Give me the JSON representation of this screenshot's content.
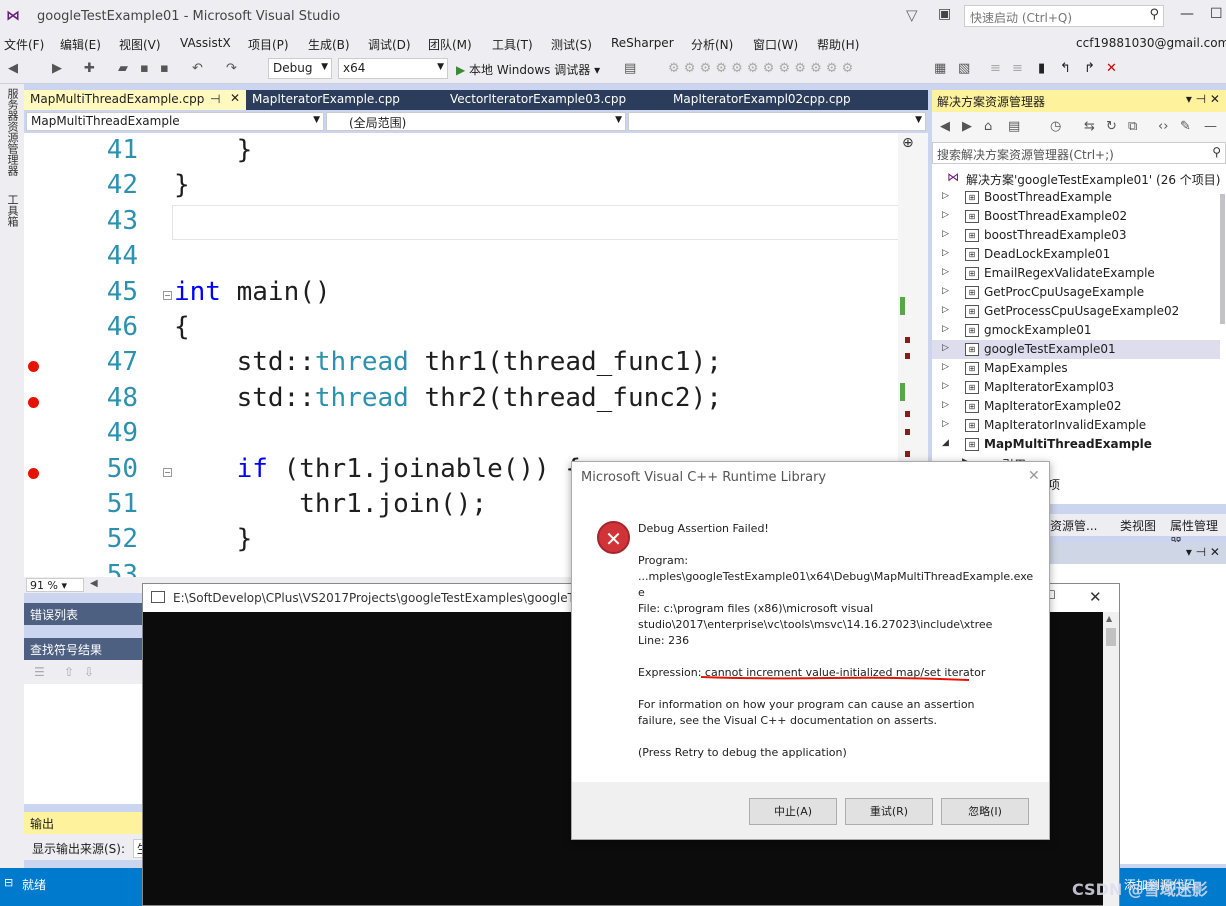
{
  "window": {
    "title": "googleTestExample01 - Microsoft Visual Studio",
    "quick_launch_placeholder": "快速启动 (Ctrl+Q)",
    "account": "ccf19881030@gmail.com"
  },
  "menu": [
    "文件(F)",
    "编辑(E)",
    "视图(V)",
    "VAssistX",
    "项目(P)",
    "生成(B)",
    "调试(D)",
    "团队(M)",
    "工具(T)",
    "测试(S)",
    "ReSharper",
    "分析(N)",
    "窗口(W)",
    "帮助(H)"
  ],
  "toolbar": {
    "config": "Debug",
    "platform": "x64",
    "run_label": "本地 Windows 调试器"
  },
  "left_strip": [
    "服务器资源管理器",
    "工具箱"
  ],
  "tabs": [
    {
      "label": "MapMultiThreadExample.cpp",
      "active": true
    },
    {
      "label": "MapIteratorExample.cpp"
    },
    {
      "label": "VectorIteratorExample03.cpp"
    },
    {
      "label": "MapIteratorExampl02cpp.cpp"
    }
  ],
  "navbar": {
    "project": "MapMultiThreadExample",
    "scope": "(全局范围)",
    "member": ""
  },
  "editor": {
    "zoom": "91 %",
    "lines": [
      {
        "n": "41",
        "code": "    }"
      },
      {
        "n": "42",
        "code": "}"
      },
      {
        "n": "43",
        "code": ""
      },
      {
        "n": "44",
        "code": ""
      },
      {
        "n": "45",
        "code_html": "<span class=\"kw\">int</span> main()"
      },
      {
        "n": "46",
        "code": "{"
      },
      {
        "n": "47",
        "code_html": "    std::<span class=\"ty\">thread</span> thr1(thread_func1);"
      },
      {
        "n": "48",
        "code_html": "    std::<span class=\"ty\">thread</span> thr2(thread_func2);"
      },
      {
        "n": "49",
        "code": ""
      },
      {
        "n": "50",
        "code_html": "    <span class=\"kw\">if</span> (thr1.joinable()) {"
      },
      {
        "n": "51",
        "code": "        thr1.join();"
      },
      {
        "n": "52",
        "code": "    }"
      },
      {
        "n": "53",
        "code": ""
      }
    ]
  },
  "panels": {
    "error_list": "错误列表",
    "find_symbol": "查找符号结果",
    "output": "输出",
    "output_source_label": "显示输出来源(S):",
    "output_source_value": "生"
  },
  "status": {
    "text": "就绪",
    "right_text": "添加到源代码"
  },
  "solution_explorer": {
    "title": "解决方案资源管理器",
    "search_placeholder": "搜索解决方案资源管理器(Ctrl+;)",
    "solution_label": "解决方案'googleTestExample01' (26 个项目)",
    "items": [
      {
        "label": "BoostThreadExample"
      },
      {
        "label": "BoostThreadExample02"
      },
      {
        "label": "boostThreadExample03"
      },
      {
        "label": "DeadLockExample01"
      },
      {
        "label": "EmailRegexValidateExample"
      },
      {
        "label": "GetProcCpuUsageExample"
      },
      {
        "label": "GetProcessCpuUsageExample02"
      },
      {
        "label": "gmockExample01"
      },
      {
        "label": "googleTestExample01",
        "selected": true
      },
      {
        "label": "MapExamples"
      },
      {
        "label": "MapIteratorExampl03"
      },
      {
        "label": "MapIteratorExample02"
      },
      {
        "label": "MapIteratorInvalidExample"
      },
      {
        "label": "MapMultiThreadExample",
        "bold": true,
        "expanded": true
      }
    ],
    "sub_item_1": "引用",
    "sub_item_2": "项",
    "bottom_tabs": [
      "资源管...",
      "类视图",
      "属性管理器"
    ]
  },
  "console": {
    "title": "E:\\SoftDevelop\\CPlus\\VS2017Projects\\googleTestExamples\\googleTe"
  },
  "dialog": {
    "title": "Microsoft Visual C++ Runtime Library",
    "heading": "Debug Assertion Failed!",
    "program_label": "Program:",
    "program_path_1": "...mples\\googleTestExample01\\x64\\Debug\\MapMultiThreadExample.exe",
    "program_path_2": "e",
    "file_line_1": "File: c:\\program files (x86)\\microsoft visual",
    "file_line_2": "studio\\2017\\enterprise\\vc\\tools\\msvc\\14.16.27023\\include\\xtree",
    "line_label": "Line: 236",
    "expression_prefix": "Expression: ",
    "expression": "cannot increment value-initialized map/set iterator",
    "info_1": "For information on how your program can cause an assertion",
    "info_2": "failure, see the Visual C++ documentation on asserts.",
    "press_retry": "(Press Retry to debug the application)",
    "buttons": {
      "abort": "中止(A)",
      "retry": "重试(R)",
      "ignore": "忽略(I)"
    }
  },
  "watermark": "CSDN @雪域迷影",
  "colors": {
    "accent": "#007acc",
    "tab_bar": "#2b3d5b",
    "active_header": "#fff29d",
    "breakpoint": "#e51400",
    "error_icon": "#d13438"
  }
}
